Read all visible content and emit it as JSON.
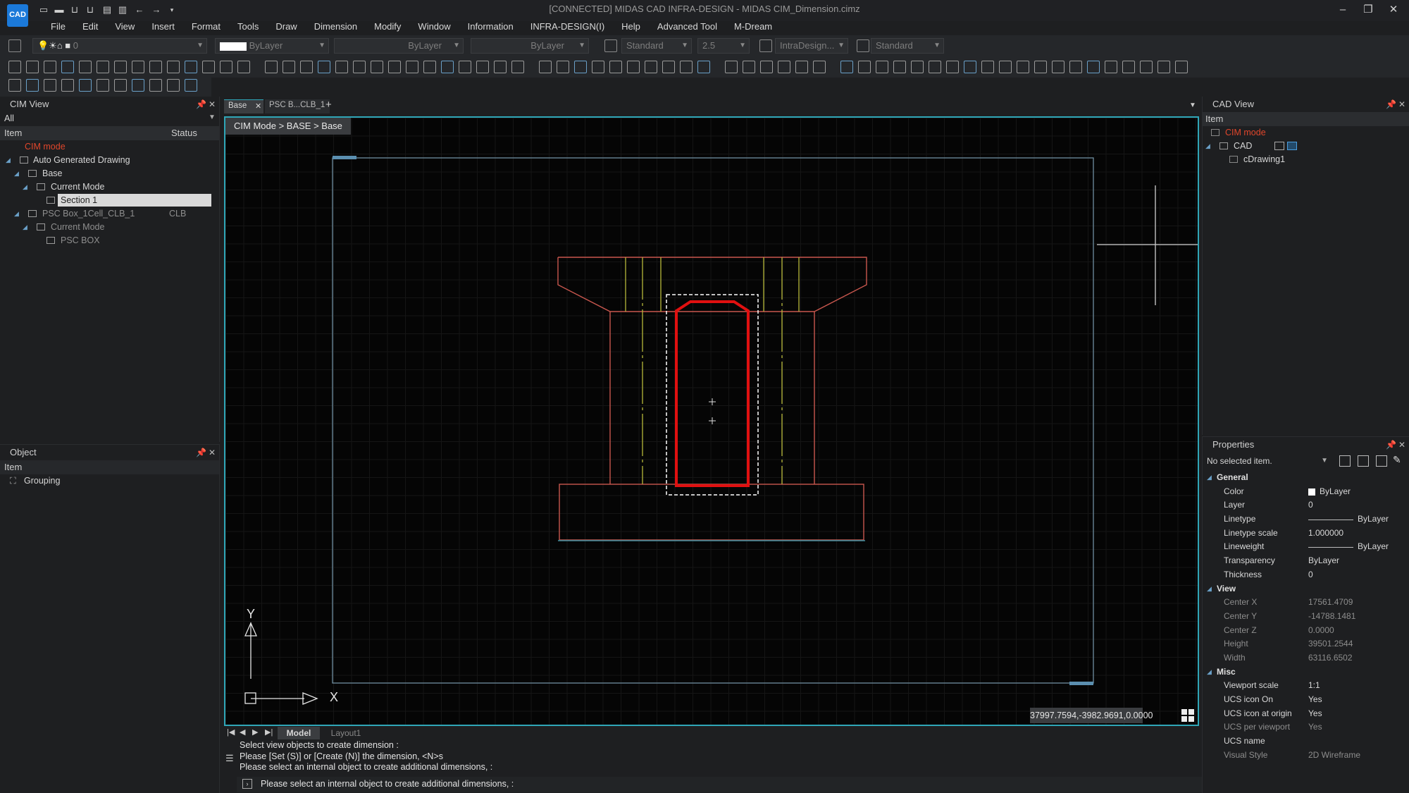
{
  "window": {
    "title": "[CONNECTED] MIDAS CAD INFRA-DESIGN - MIDAS CIM_Dimension.cimz",
    "logo": "CAD",
    "controls": [
      "minimize-icon",
      "restore-icon",
      "close-icon"
    ]
  },
  "menu": [
    "File",
    "Edit",
    "View",
    "Insert",
    "Format",
    "Tools",
    "Draw",
    "Dimension",
    "Modify",
    "Window",
    "Information",
    "INFRA-DESIGN(I)",
    "Help",
    "Advanced Tool",
    "M-Dream"
  ],
  "properties_toolbar": {
    "layer_value": "0",
    "color_value": "ByLayer",
    "linetype_value": "ByLayer",
    "lineweight_value": "ByLayer",
    "text_style": "Standard",
    "text_height": "2.5",
    "dim_style": "IntraDesign...",
    "table_style": "Standard"
  },
  "cim_view": {
    "title": "CIM View",
    "filter": "All",
    "col_item": "Item",
    "col_status": "Status",
    "tree": [
      {
        "label": "CIM mode",
        "status": ""
      },
      {
        "label": "Auto Generated Drawing",
        "status": ""
      },
      {
        "label": "Base",
        "status": ""
      },
      {
        "label": "Current Mode",
        "status": ""
      },
      {
        "label": "Section 1",
        "status": ""
      },
      {
        "label": "PSC Box_1Cell_CLB_1",
        "status": "CLB"
      },
      {
        "label": "Current Mode",
        "status": ""
      },
      {
        "label": "PSC BOX",
        "status": ""
      }
    ]
  },
  "object_panel": {
    "title": "Object",
    "col_item": "Item",
    "items": [
      "Grouping"
    ]
  },
  "doc_tabs": [
    {
      "label": "Base",
      "active": true
    },
    {
      "label": "PSC B...CLB_1",
      "active": false
    }
  ],
  "viewport": {
    "breadcrumb": "CIM Mode > BASE > Base",
    "coords": "37997.7594,-3982.9691,0.0000",
    "ucs_x": "X",
    "ucs_y": "Y"
  },
  "layout_tabs": [
    "Model",
    "Layout1"
  ],
  "console": {
    "lines": [
      "Select view objects to create dimension :",
      "Please [Set (S)] or [Create (N)] the dimension, <N>s",
      "Please select an internal object to create additional dimensions, :"
    ],
    "prompt": "Please select an internal object to create additional dimensions, :"
  },
  "cad_view": {
    "title": "CAD View",
    "col_item": "Item",
    "tree": [
      "CIM mode",
      "CAD",
      "cDrawing1"
    ]
  },
  "properties": {
    "title": "Properties",
    "selection": "No selected item.",
    "categories": [
      {
        "name": "General",
        "rows": [
          {
            "k": "Color",
            "v": "ByLayer"
          },
          {
            "k": "Layer",
            "v": "0"
          },
          {
            "k": "Linetype",
            "v": "ByLayer"
          },
          {
            "k": "Linetype scale",
            "v": "1.000000"
          },
          {
            "k": "Lineweight",
            "v": "ByLayer"
          },
          {
            "k": "Transparency",
            "v": "ByLayer"
          },
          {
            "k": "Thickness",
            "v": "0"
          }
        ]
      },
      {
        "name": "View",
        "rows": [
          {
            "k": "Center X",
            "v": "17561.4709"
          },
          {
            "k": "Center Y",
            "v": "-14788.1481"
          },
          {
            "k": "Center Z",
            "v": "0.0000"
          },
          {
            "k": "Height",
            "v": "39501.2544"
          },
          {
            "k": "Width",
            "v": "63116.6502"
          }
        ]
      },
      {
        "name": "Misc",
        "rows": [
          {
            "k": "Viewport scale",
            "v": "1:1"
          },
          {
            "k": "UCS icon On",
            "v": "Yes"
          },
          {
            "k": "UCS icon at origin",
            "v": "Yes"
          },
          {
            "k": "UCS per viewport",
            "v": "Yes"
          },
          {
            "k": "UCS name",
            "v": ""
          },
          {
            "k": "Visual Style",
            "v": "2D Wireframe"
          }
        ]
      }
    ]
  },
  "colors": {
    "accent_cyan": "#2fa6b7",
    "cim_mode_red": "#e0462b",
    "drawing_outline": "#c9574e",
    "drawing_highlight": "#e01010",
    "centerline_yellow": "#b7b83a"
  }
}
